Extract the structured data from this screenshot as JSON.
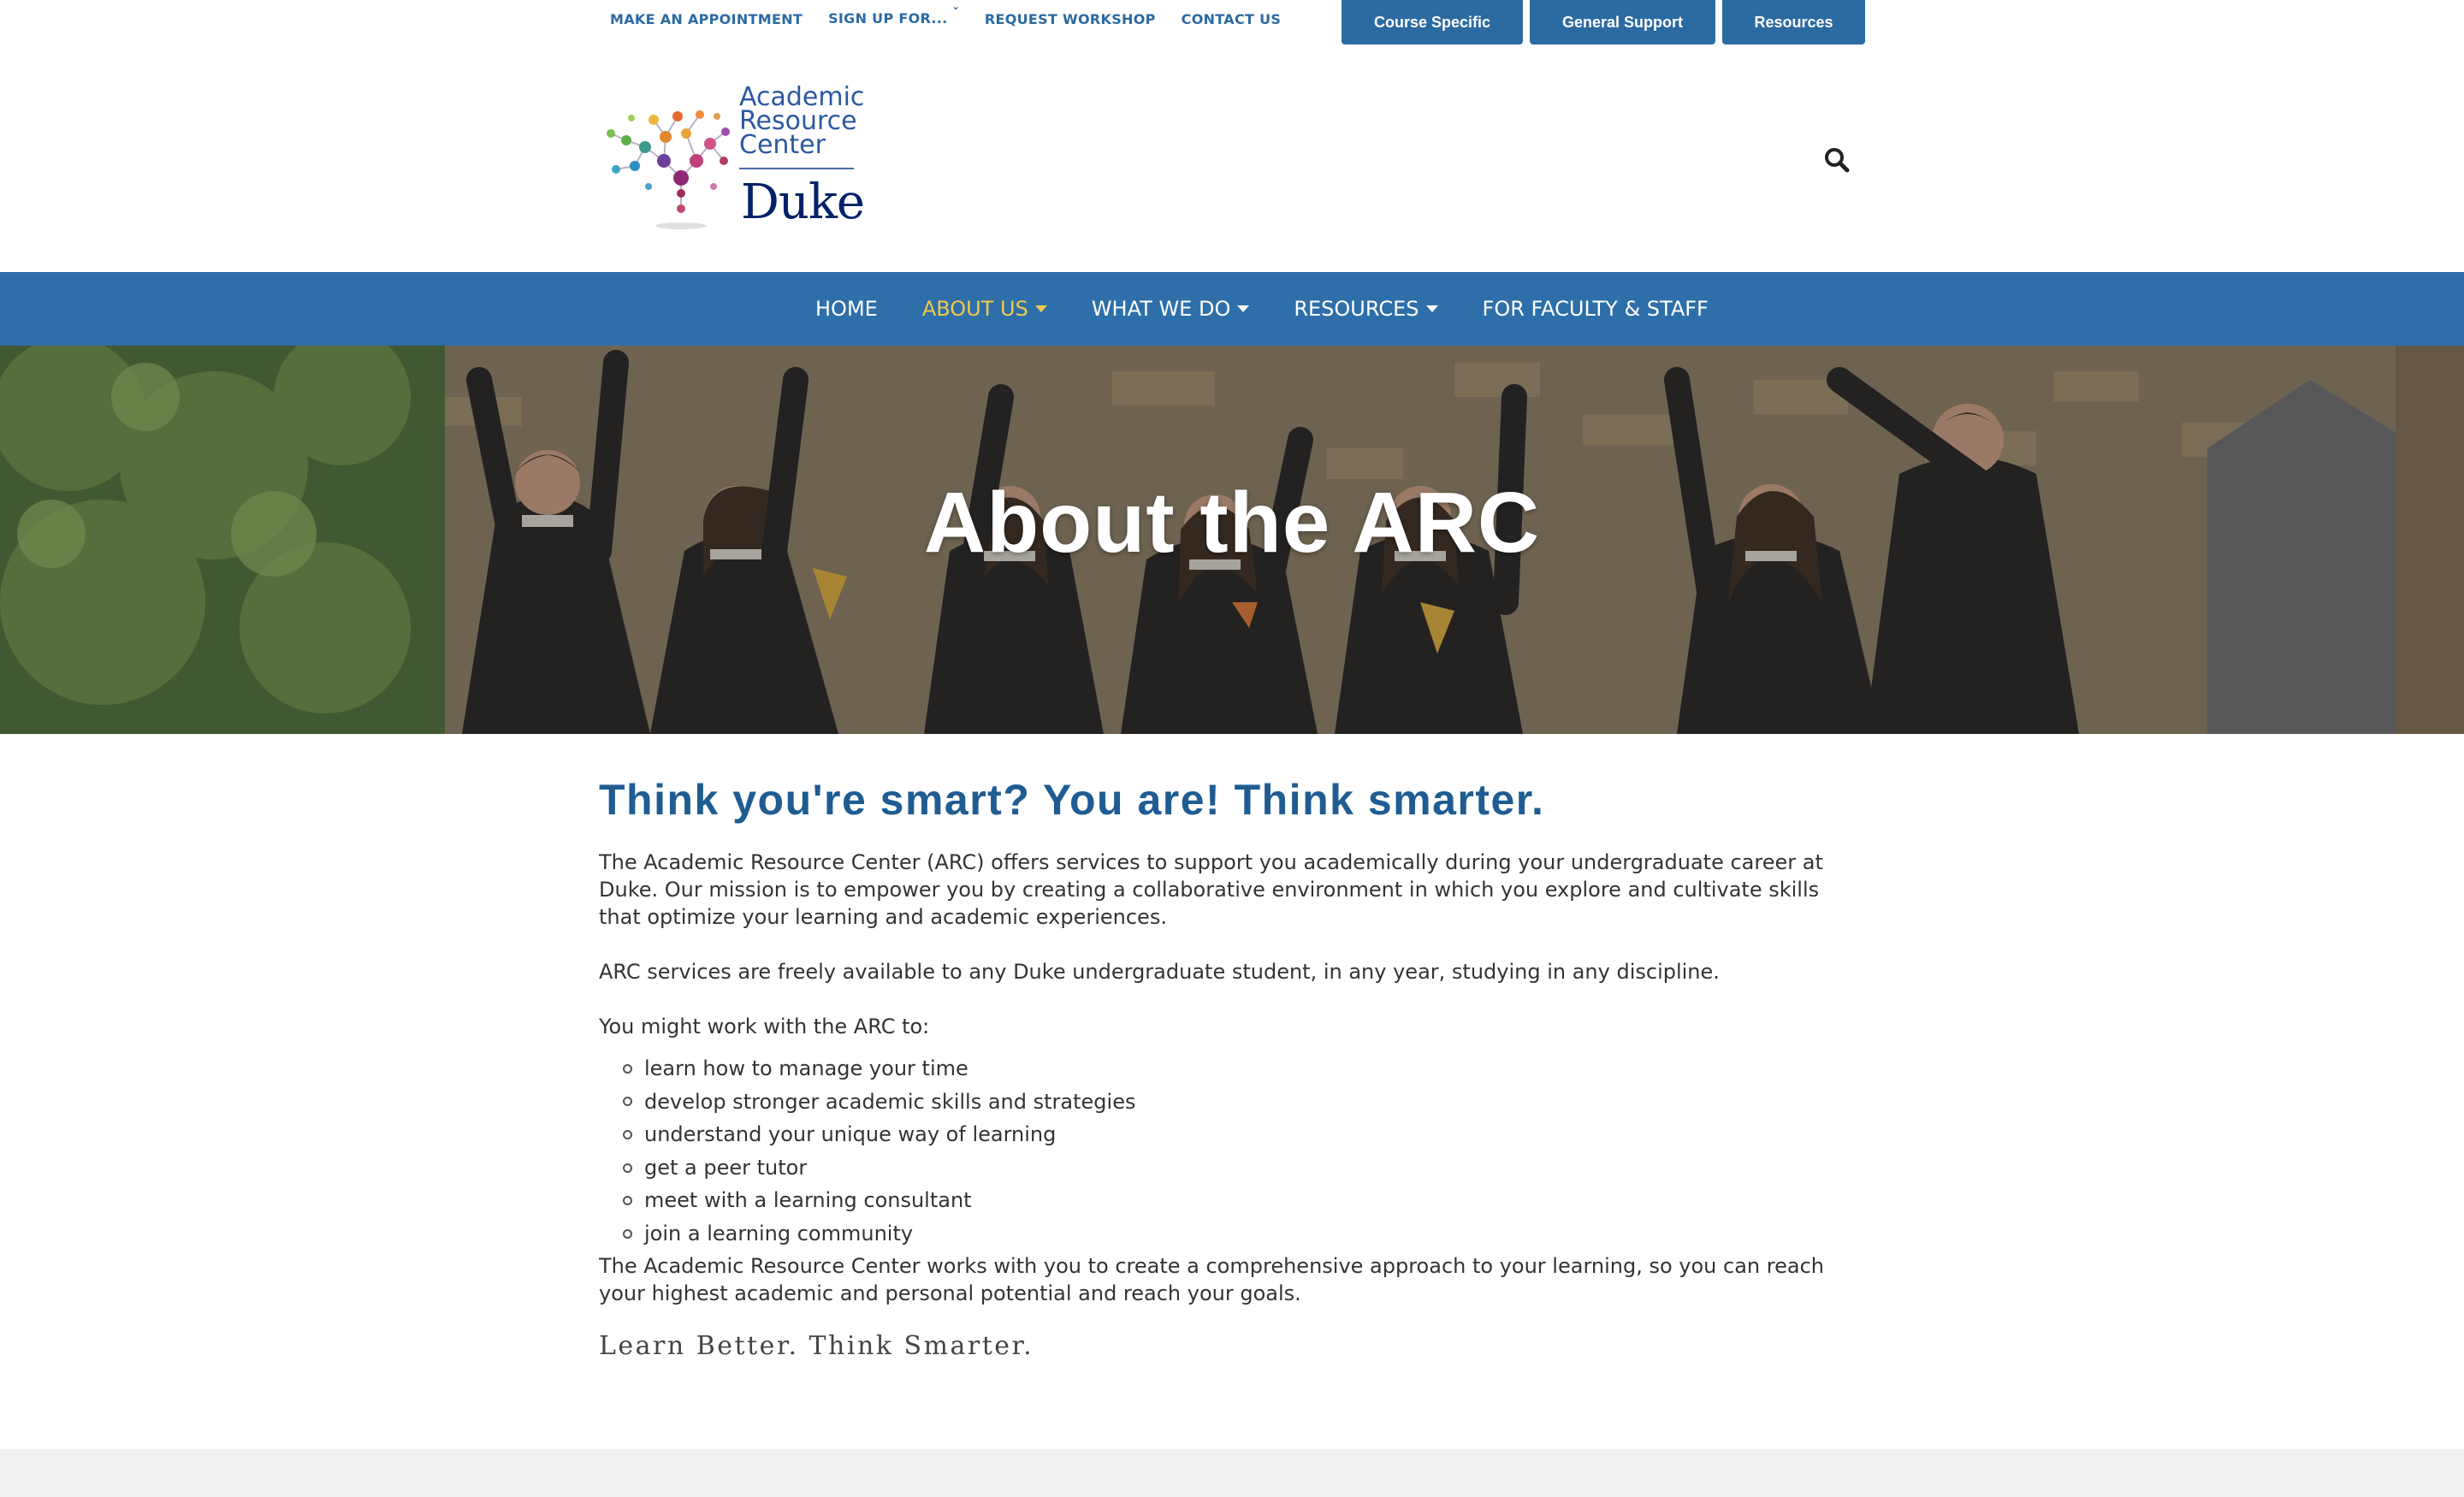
{
  "utility_nav": {
    "links": [
      {
        "label": "MAKE AN APPOINTMENT"
      },
      {
        "label": "SIGN UP FOR...",
        "has_dropdown": true
      },
      {
        "label": "REQUEST WORKSHOP"
      },
      {
        "label": "CONTACT US"
      }
    ],
    "buttons": [
      "Course Specific",
      "General Support",
      "Resources"
    ]
  },
  "logo": {
    "line1": "Academic",
    "line2": "Resource",
    "line3": "Center",
    "wordmark": "Duke"
  },
  "main_nav": {
    "items": [
      {
        "label": "HOME",
        "active": false,
        "has_dropdown": false
      },
      {
        "label": "ABOUT US",
        "active": true,
        "has_dropdown": true
      },
      {
        "label": "WHAT WE DO",
        "active": false,
        "has_dropdown": true
      },
      {
        "label": "RESOURCES",
        "active": false,
        "has_dropdown": true
      },
      {
        "label": "FOR FACULTY & STAFF",
        "active": false,
        "has_dropdown": false
      }
    ]
  },
  "hero": {
    "title": "About the ARC"
  },
  "content": {
    "headline": "Think you're smart? You are! Think smarter.",
    "para1": "The Academic Resource Center (ARC) offers services to support you academically during your undergraduate career at Duke.  Our mission is to empower you by creating a collaborative environment in which you explore and cultivate skills that optimize your learning and academic experiences.",
    "para2": "ARC services are freely available to any Duke undergraduate student, in any year, studying in any discipline.",
    "para3": "You might work with the ARC to:",
    "bullets": [
      "learn how to manage your time",
      "develop stronger academic skills and strategies",
      "understand your unique way of learning",
      "get a peer tutor",
      "meet with a learning consultant",
      "join a learning community"
    ],
    "para4": "The Academic Resource Center works with you to create a comprehensive approach to your learning, so you can reach your highest academic and personal potential and reach your goals.",
    "tagline": "Learn Better. Think Smarter."
  },
  "colors": {
    "brand_blue": "#2e6fa9",
    "headline_blue": "#1f5c92",
    "active_nav": "#f2c94c",
    "duke_navy": "#012169"
  },
  "icons": {
    "search": "magnifying-glass"
  }
}
